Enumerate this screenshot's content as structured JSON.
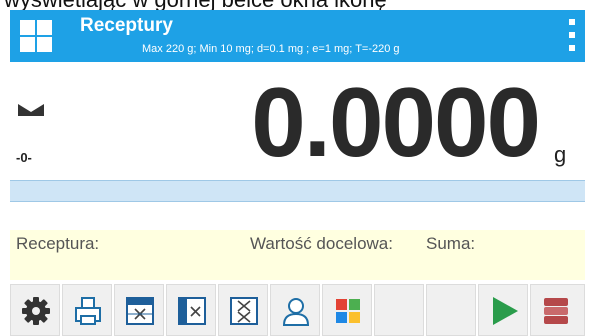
{
  "caption": "wyświetlając w górnej belce okna ikonę",
  "header": {
    "title": "Receptury",
    "subtitle": "Max 220 g; Min 10 mg; d=0.1 mg ; e=1 mg; T=-220 g",
    "home_icon": "home-grid-icon",
    "menu_icon": "more-vertical-icon"
  },
  "readout": {
    "stability_icon": "stability-indicator-icon",
    "zero_indicator": "-0-",
    "value": "0.0000",
    "unit": "g"
  },
  "progress": {
    "fraction": 0.0
  },
  "info": {
    "recipe_label": "Receptura:",
    "target_label": "Wartość docelowa:",
    "sum_label": "Suma:"
  },
  "toolbar": {
    "buttons": [
      {
        "icon": "gear-icon"
      },
      {
        "icon": "printer-icon"
      },
      {
        "icon": "database-table-icon"
      },
      {
        "icon": "database-table-icon"
      },
      {
        "icon": "database-table-icon"
      },
      {
        "icon": "user-icon"
      },
      {
        "icon": "colored-grid-icon"
      },
      {
        "icon": "empty-slot"
      },
      {
        "icon": "empty-slot"
      },
      {
        "icon": "play-icon"
      },
      {
        "icon": "database-icon"
      }
    ]
  },
  "colors": {
    "header_bg": "#1ea1e6",
    "info_bg": "#ffffe0",
    "progress_bg": "#cfe5f6",
    "play_green": "#2a9c4b",
    "database_red": "#b5484a"
  }
}
